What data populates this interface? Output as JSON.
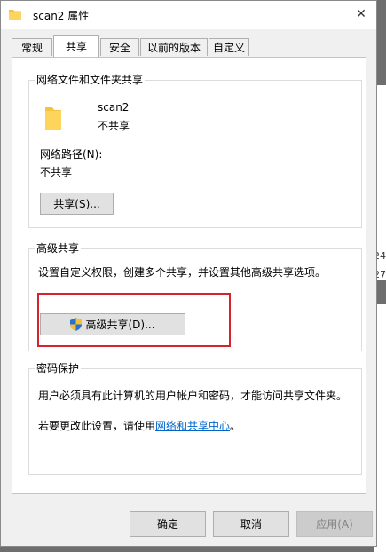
{
  "window": {
    "title": "scan2 属性",
    "close_label": "✕"
  },
  "tabs": [
    {
      "label": "常规"
    },
    {
      "label": "共享",
      "active": true
    },
    {
      "label": "安全"
    },
    {
      "label": "以前的版本"
    },
    {
      "label": "自定义"
    }
  ],
  "network_sharing": {
    "group_title": "网络文件和文件夹共享",
    "folder_name": "scan2",
    "share_status": "不共享",
    "path_label": "网络路径(N):",
    "path_value": "不共享",
    "share_button": "共享(S)..."
  },
  "advanced_sharing": {
    "group_title": "高级共享",
    "description": "设置自定义权限，创建多个共享，并设置其他高级共享选项。",
    "button": "高级共享(D)..."
  },
  "password_protection": {
    "group_title": "密码保护",
    "description": "用户必须具有此计算机的用户帐户和密码，才能访问共享文件夹。",
    "change_prefix": "若要更改此设置，请使用",
    "change_link": "网络和共享中心",
    "change_suffix": "。"
  },
  "footer": {
    "ok": "确定",
    "cancel": "取消",
    "apply": "应用(A)"
  },
  "background": {
    "right_text_1": "24",
    "right_text_2": "27"
  },
  "colors": {
    "highlight": "#d6222a",
    "link": "#0066cc",
    "folder": "#f5c342"
  }
}
